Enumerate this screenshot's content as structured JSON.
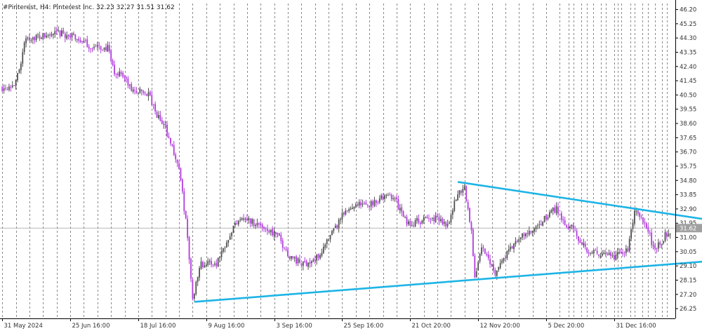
{
  "header": {
    "symbol_line": "#Pinterest, H4:  Pinterest Inc.  32.23 32.27 31.51 31.62"
  },
  "colors": {
    "background": "#ffffff",
    "bull_candle": "#505050",
    "bear_candle": "#b23cdc",
    "trendline": "#1eb4e6",
    "grid": "#6e6e6e",
    "price_line": "#a0a0a0",
    "price_tag_bg": "#a0a0a0"
  },
  "chart_data": {
    "type": "candlestick",
    "title": "#Pinterest, H4: Pinterest Inc.",
    "ohlc_header": {
      "open": 32.23,
      "high": 32.27,
      "low": 31.51,
      "close": 31.62
    },
    "current_price_label": "31.62",
    "y_axis_ticks": [
      "46.20",
      "45.25",
      "44.30",
      "43.35",
      "42.40",
      "41.45",
      "40.50",
      "39.55",
      "38.60",
      "37.65",
      "36.70",
      "35.75",
      "34.80",
      "33.85",
      "32.90",
      "31.95",
      "31.00",
      "30.05",
      "29.10",
      "28.15",
      "27.20",
      "26.25"
    ],
    "ylim": [
      25.6,
      46.6
    ],
    "x_axis_labels": [
      "31 May 2024",
      "25 Jun 16:00",
      "18 Jul 16:00",
      "9 Aug 16:00",
      "3 Sep 16:00",
      "25 Sep 16:00",
      "21 Oct 20:00",
      "12 Nov 20:00",
      "5 Dec 20:00",
      "31 Dec 16:00"
    ],
    "x_label_bars": [
      0,
      40,
      80,
      120,
      160,
      200,
      240,
      280,
      320,
      360
    ],
    "bar_count": 394,
    "grid": true,
    "price_path": [
      [
        0,
        41.0
      ],
      [
        8,
        41.3
      ],
      [
        14,
        44.3
      ],
      [
        24,
        44.4
      ],
      [
        34,
        44.6
      ],
      [
        44,
        44.3
      ],
      [
        52,
        43.7
      ],
      [
        62,
        43.6
      ],
      [
        66,
        41.9
      ],
      [
        70,
        42.0
      ],
      [
        76,
        40.8
      ],
      [
        86,
        40.6
      ],
      [
        90,
        39.3
      ],
      [
        96,
        38.3
      ],
      [
        100,
        37.0
      ],
      [
        104,
        35.6
      ],
      [
        108,
        32.1
      ],
      [
        110,
        29.6
      ],
      [
        112,
        26.8
      ],
      [
        116,
        29.2
      ],
      [
        126,
        29.3
      ],
      [
        134,
        31.3
      ],
      [
        140,
        32.4
      ],
      [
        146,
        32.1
      ],
      [
        154,
        31.7
      ],
      [
        162,
        31.1
      ],
      [
        168,
        29.9
      ],
      [
        176,
        29.2
      ],
      [
        184,
        29.5
      ],
      [
        192,
        30.8
      ],
      [
        200,
        32.4
      ],
      [
        208,
        33.3
      ],
      [
        214,
        33.1
      ],
      [
        222,
        33.6
      ],
      [
        230,
        33.8
      ],
      [
        238,
        31.9
      ],
      [
        246,
        32.1
      ],
      [
        254,
        32.3
      ],
      [
        262,
        31.9
      ],
      [
        268,
        33.9
      ],
      [
        272,
        34.4
      ],
      [
        276,
        31.3
      ],
      [
        278,
        28.4
      ],
      [
        282,
        30.3
      ],
      [
        286,
        29.6
      ],
      [
        290,
        28.7
      ],
      [
        298,
        30.1
      ],
      [
        306,
        31.1
      ],
      [
        314,
        31.5
      ],
      [
        322,
        32.6
      ],
      [
        326,
        33.0
      ],
      [
        330,
        32.1
      ],
      [
        336,
        31.5
      ],
      [
        344,
        30.2
      ],
      [
        352,
        29.8
      ],
      [
        360,
        29.7
      ],
      [
        368,
        30.2
      ],
      [
        372,
        32.7
      ],
      [
        378,
        32.0
      ],
      [
        384,
        30.1
      ],
      [
        390,
        31.1
      ],
      [
        394,
        31.6
      ]
    ],
    "trendlines": [
      {
        "name": "upper",
        "points": [
          [
            268,
            34.7
          ],
          [
            414,
            32.2
          ]
        ]
      },
      {
        "name": "lower",
        "points": [
          [
            113,
            26.7
          ],
          [
            414,
            29.4
          ]
        ]
      }
    ]
  }
}
